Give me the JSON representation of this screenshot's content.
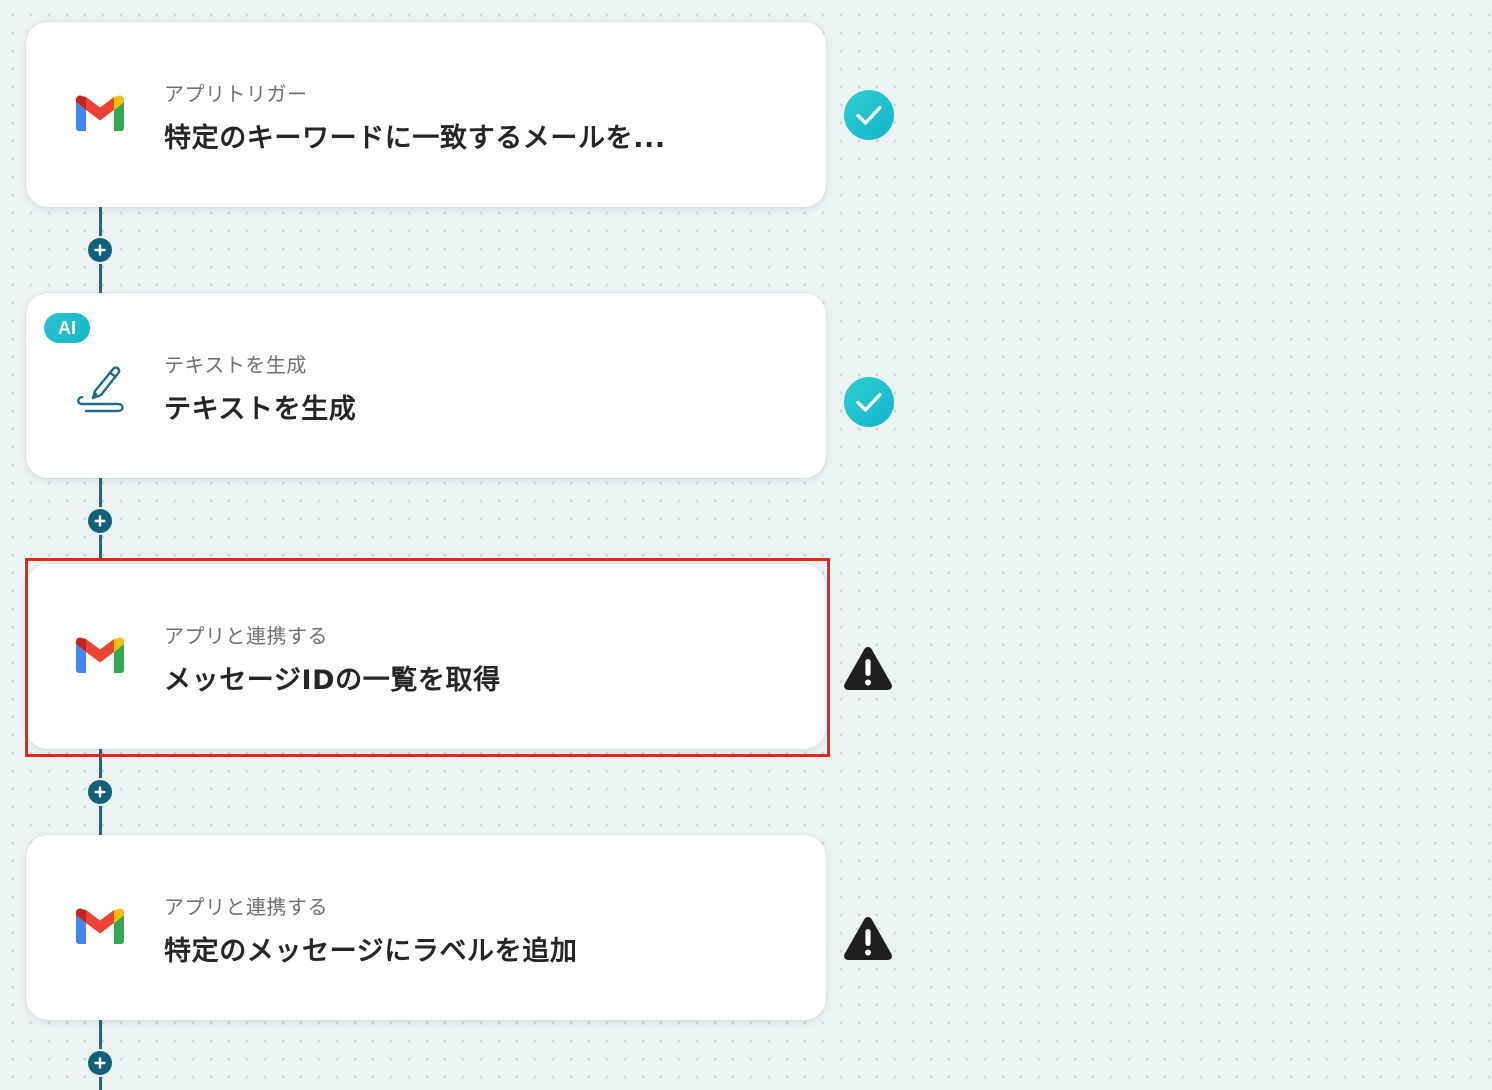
{
  "steps": [
    {
      "kicker": "アプリトリガー",
      "title": "特定のキーワードに一致するメールを...",
      "icon": "gmail-icon",
      "status": "success",
      "ai_badge": ""
    },
    {
      "kicker": "テキストを生成",
      "title": "テキストを生成",
      "icon": "pen-icon",
      "status": "success",
      "ai_badge": "AI"
    },
    {
      "kicker": "アプリと連携する",
      "title": "メッセージIDの一覧を取得",
      "icon": "gmail-icon",
      "status": "warning",
      "ai_badge": ""
    },
    {
      "kicker": "アプリと連携する",
      "title": "特定のメッセージにラベルを追加",
      "icon": "gmail-icon",
      "status": "warning",
      "ai_badge": ""
    }
  ],
  "colors": {
    "success": "#1bbfd0",
    "warning": "#1f1f1f",
    "connector": "#1d6a80",
    "highlight": "#e5261b"
  }
}
